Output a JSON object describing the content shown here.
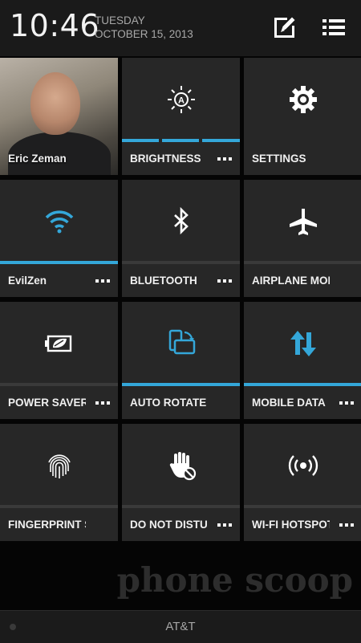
{
  "status": {
    "time": "10:46",
    "day": "TUESDAY",
    "date": "OCTOBER 15, 2013"
  },
  "header": {
    "edit_icon": "edit-icon",
    "list_icon": "list-icon"
  },
  "colors": {
    "accent": "#34a7d9",
    "tile": "#272727",
    "background": "#050505"
  },
  "tiles": [
    {
      "label": "Eric Zeman",
      "icon": "profile-photo"
    },
    {
      "label": "BRIGHTNESS",
      "icon": "brightness-auto-icon",
      "segments_on": 3
    },
    {
      "label": "SETTINGS",
      "icon": "gear-icon"
    },
    {
      "label": "EvilZen",
      "icon": "wifi-icon",
      "active": true
    },
    {
      "label": "BLUETOOTH",
      "icon": "bluetooth-icon",
      "active": false
    },
    {
      "label": "AIRPLANE MODE",
      "icon": "airplane-icon",
      "active": false
    },
    {
      "label": "POWER SAVER",
      "icon": "battery-saver-icon",
      "active": false
    },
    {
      "label": "AUTO ROTATE",
      "icon": "rotate-icon",
      "active": true
    },
    {
      "label": "MOBILE DATA",
      "icon": "data-arrows-icon",
      "active": true
    },
    {
      "label": "FINGERPRINT SCAN",
      "icon": "fingerprint-icon",
      "active": false
    },
    {
      "label": "DO NOT DISTURB",
      "icon": "do-not-disturb-icon",
      "active": false
    },
    {
      "label": "WI-FI HOTSPOT",
      "icon": "hotspot-icon",
      "active": false
    }
  ],
  "carrier": "AT&T",
  "watermark": "phone scoop"
}
